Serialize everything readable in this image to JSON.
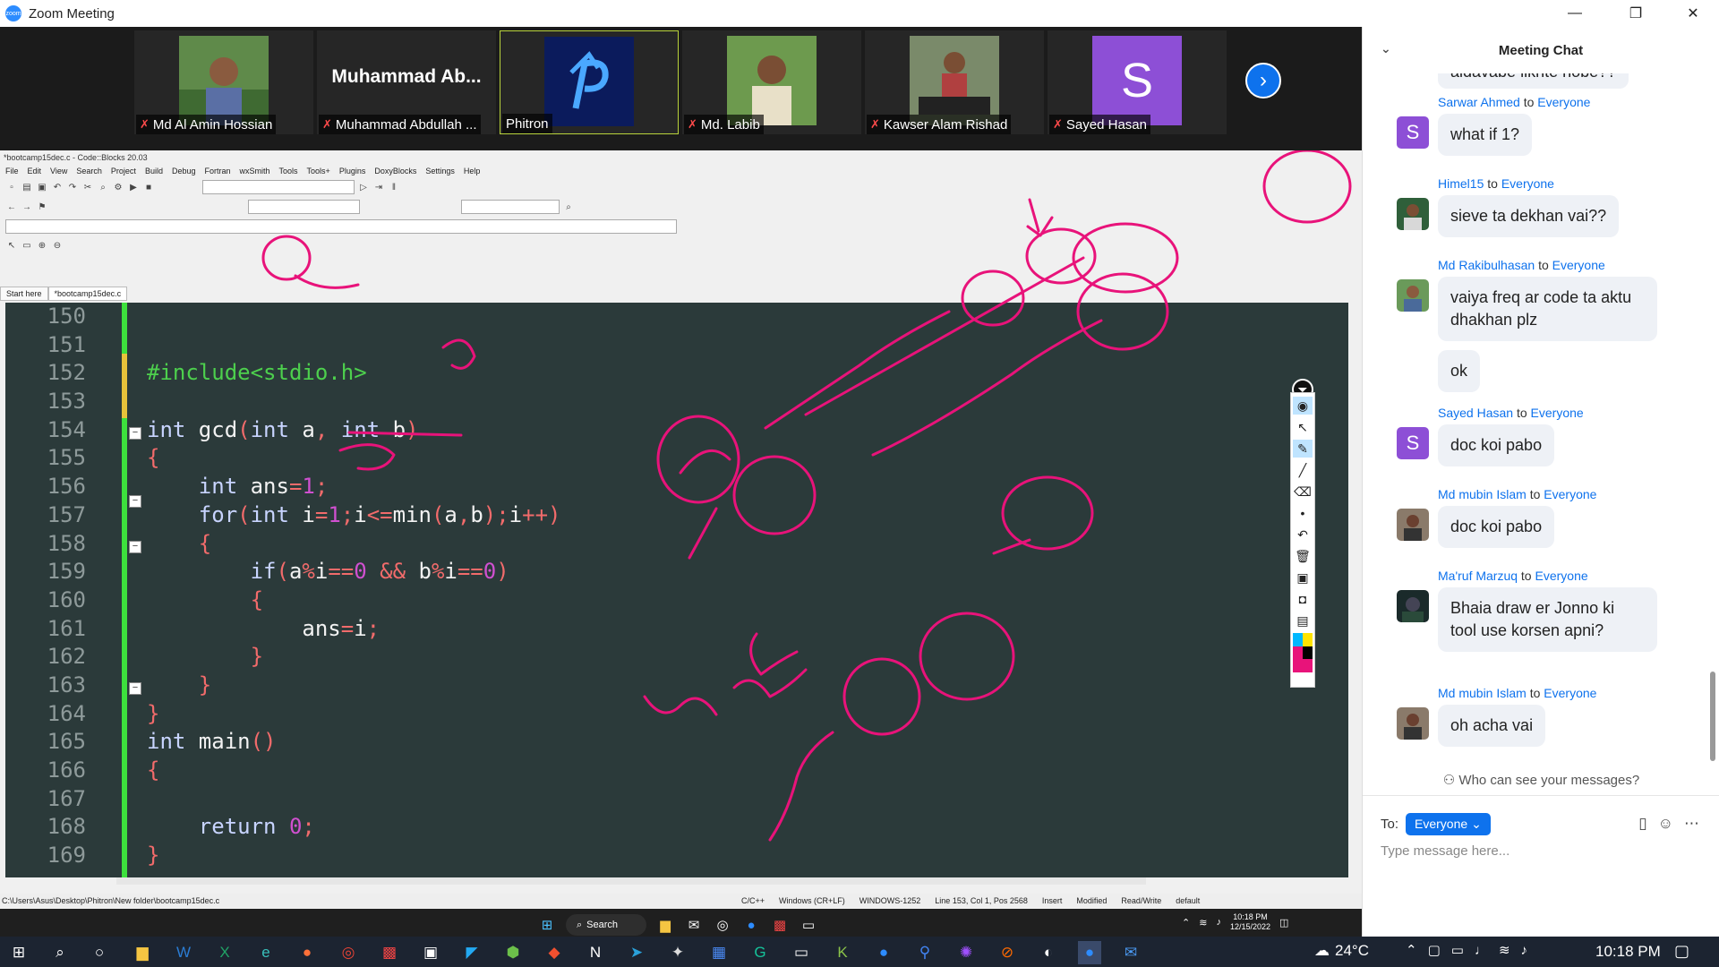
{
  "window": {
    "title": "Zoom Meeting",
    "minimize": "—",
    "restore": "❐",
    "close": "✕"
  },
  "gallery": {
    "participants": [
      {
        "name": "Md Al Amin Hossian",
        "muted": true,
        "kind": "photo"
      },
      {
        "name": "Muhammad Abdullah ...",
        "display": "Muhammad  Ab...",
        "muted": true,
        "kind": "name"
      },
      {
        "name": "Phitron",
        "muted": false,
        "kind": "logo",
        "active": true
      },
      {
        "name": "Md. Labib",
        "muted": true,
        "kind": "photo"
      },
      {
        "name": "Kawser Alam Rishad",
        "muted": true,
        "kind": "photo"
      },
      {
        "name": "Sayed Hasan",
        "muted": true,
        "kind": "letter",
        "letter": "S"
      }
    ],
    "next": "›"
  },
  "codeblocks": {
    "title": "*bootcamp15dec.c - Code::Blocks 20.03",
    "menu": [
      "File",
      "Edit",
      "View",
      "Search",
      "Project",
      "Build",
      "Debug",
      "Fortran",
      "wxSmith",
      "Tools",
      "Tools+",
      "Plugins",
      "DoxyBlocks",
      "Settings",
      "Help"
    ],
    "tabs": [
      "Start here",
      "*bootcamp15dec.c"
    ],
    "line_numbers": [
      "150",
      "151",
      "152",
      "153",
      "154",
      "155",
      "156",
      "157",
      "158",
      "159",
      "160",
      "161",
      "162",
      "163",
      "164",
      "165",
      "166",
      "167",
      "168",
      "169"
    ],
    "lines": {
      "l152": "#include<stdio.h>",
      "l154a": "int",
      "l154b": " gcd",
      "l154c": "(",
      "l154d": "int",
      "l154e": " a",
      "l154f": ",",
      "l154g": " int",
      "l154h": " b",
      "l154i": ")",
      "l155": "{",
      "l156a": "    int",
      "l156b": " ans",
      "l156c": "=",
      "l156d": "1",
      "l156e": ";",
      "l157a": "    for",
      "l157b": "(",
      "l157c": "int",
      "l157d": " i",
      "l157e": "=",
      "l157f": "1",
      "l157g": ";",
      "l157h": "i",
      "l157i": "<=",
      "l157j": "min",
      "l157k": "(",
      "l157l": "a",
      "l157m": ",",
      "l157n": "b",
      "l157o": ");",
      "l157p": "i",
      "l157q": "++)",
      "l158": "    {",
      "l159a": "        if",
      "l159b": "(",
      "l159c": "a",
      "l159d": "%",
      "l159e": "i",
      "l159f": "==",
      "l159g": "0",
      "l159h": " &&",
      "l159i": " b",
      "l159j": "%",
      "l159k": "i",
      "l159l": "==",
      "l159m": "0",
      "l159n": ")",
      "l160": "        {",
      "l161a": "            ans",
      "l161b": "=",
      "l161c": "i",
      "l161d": ";",
      "l162": "        }",
      "l163": "    }",
      "l164": "}",
      "l165a": "int",
      "l165b": " main",
      "l165c": "()",
      "l166": "{",
      "l168a": "    return",
      "l168b": " 0",
      "l168c": ";",
      "l169": "}"
    },
    "status": {
      "path": "C:\\Users\\Asus\\Desktop\\Phitron\\New folder\\bootcamp15dec.c",
      "lang": "C/C++",
      "eol": "Windows (CR+LF)",
      "encoding": "WINDOWS-1252",
      "position": "Line 153, Col 1, Pos 2568",
      "mode": "Insert",
      "modified": "Modified",
      "access": "Read/Write",
      "profile": "default"
    }
  },
  "inner_taskbar": {
    "search": "Search",
    "time": "10:18 PM",
    "date": "12/15/2022"
  },
  "chat": {
    "header": "Meeting Chat",
    "partial_top": "aidavabe likhte hobe??",
    "messages": [
      {
        "sender": "Sarwar Ahmed",
        "to": "Everyone",
        "avatar": "letter",
        "letter": "S",
        "text": "what if 1?"
      },
      {
        "sender": "Himel15",
        "to": "Everyone",
        "avatar": "photo",
        "text": "sieve ta dekhan vai??"
      },
      {
        "sender": "Md Rakibulhasan",
        "to": "Everyone",
        "avatar": "photo",
        "text": "vaiya freq ar code ta aktu dhakhan plz",
        "extra": "ok"
      },
      {
        "sender": "Sayed Hasan",
        "to": "Everyone",
        "avatar": "letter",
        "letter": "S",
        "text": "doc koi pabo"
      },
      {
        "sender": "Md mubin Islam",
        "to": "Everyone",
        "avatar": "photo",
        "text": "doc koi pabo"
      },
      {
        "sender": "Ma'ruf Marzuq",
        "to": "Everyone",
        "avatar": "photo",
        "text": "Bhaia draw er Jonno ki tool use korsen apni?"
      },
      {
        "sender": "Md mubin Islam",
        "to": "Everyone",
        "avatar": "photo",
        "text": "oh   acha vai"
      }
    ],
    "to_word": "to",
    "who_can_see": "Who can see your messages?",
    "to_label": "To:",
    "to_value": "Everyone",
    "placeholder": "Type message here..."
  },
  "taskbar": {
    "weather": "24°C",
    "time": "10:18 PM"
  },
  "colors": {
    "ink": "#e8137a",
    "zoom_blue": "#0e72ed",
    "editor_bg": "#2b3a3a"
  }
}
